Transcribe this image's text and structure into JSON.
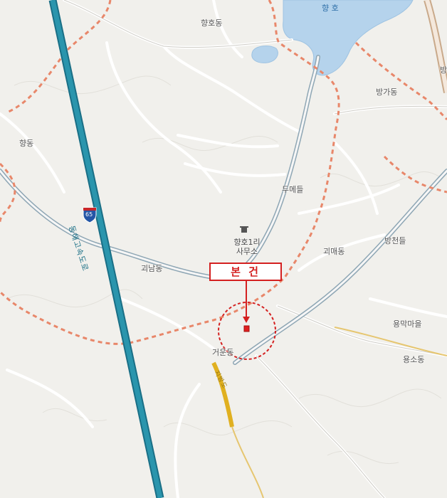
{
  "map": {
    "water": {
      "lake_label": "향 호"
    },
    "places": {
      "hyangho_dong": "향호동",
      "banga_dong": "방가동",
      "hyang_dong": "향동",
      "dume_deul": "두메들",
      "goenam_dong": "괴남동",
      "goemae_dong": "괴매동",
      "bangcheon_deul": "방천들",
      "yongmak_maeul": "용막마을",
      "yongso_dong": "용소동",
      "geoeun_dong": "거운동",
      "edge_label_right": "방"
    },
    "office": {
      "line1": "향호1리",
      "line2": "사무소"
    },
    "highway": {
      "shield_number": "65",
      "name": "동해고속도로"
    },
    "local_road": {
      "name": "지방도"
    },
    "marker": {
      "label": "본 건"
    },
    "colors": {
      "background": "#f1f0ec",
      "water": "#b5d3ec",
      "highway": "#2a95ad",
      "boundary": "#e8876a",
      "road": "#ffffff",
      "road_outline": "#c8c8c4",
      "marker_red": "#d42020",
      "local_road": "#e0b020"
    }
  }
}
